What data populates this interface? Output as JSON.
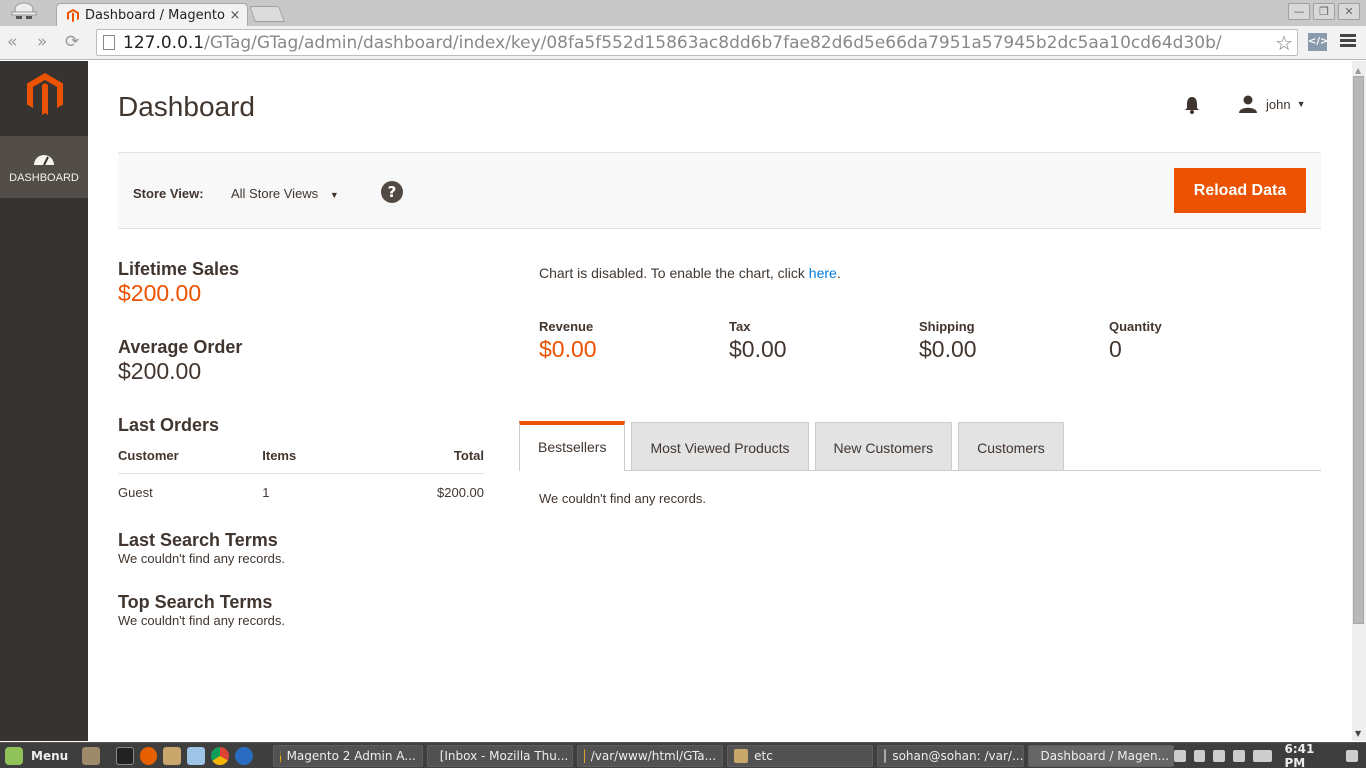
{
  "browser": {
    "tab_title": "Dashboard / Magento A",
    "tab_close": "×",
    "url_host": "127.0.0.1",
    "url_path": "/GTag/GTag/admin/dashboard/index/key/08fa5f552d15863ac8dd6b7fae82d6d5e66da7951a57945b2dc5aa10cd64d30b/",
    "star_glyph": "☆",
    "devtools_glyph": "</>",
    "window_buttons": [
      "—",
      "❐",
      "✕"
    ],
    "icons": [
      "incognito-icon",
      "back-icon",
      "forward-icon",
      "reload-icon",
      "page-icon",
      "bookmark-star-icon",
      "devtools-icon",
      "menu-icon"
    ]
  },
  "sidebar": {
    "items": [
      {
        "label": "DASHBOARD",
        "icon": "gauge-icon"
      }
    ]
  },
  "header": {
    "title": "Dashboard",
    "user_name": "john",
    "caret": "▼"
  },
  "store_view": {
    "label": "Store View:",
    "selected": "All Store Views",
    "caret": "▼",
    "help": "?",
    "reload_button": "Reload Data"
  },
  "left": {
    "lifetime_sales": {
      "label": "Lifetime Sales",
      "value": "$200.00"
    },
    "average_order": {
      "label": "Average Order",
      "value": "$200.00"
    },
    "last_orders": {
      "title": "Last Orders",
      "columns": [
        "Customer",
        "Items",
        "Total"
      ],
      "rows": [
        {
          "customer": "Guest",
          "items": "1",
          "total": "$200.00"
        }
      ]
    },
    "last_search_terms": {
      "title": "Last Search Terms",
      "empty": "We couldn't find any records."
    },
    "top_search_terms": {
      "title": "Top Search Terms",
      "empty": "We couldn't find any records."
    }
  },
  "right": {
    "chart_msg": "Chart is disabled. To enable the chart, click ",
    "chart_link": "here",
    "chart_msg_end": ".",
    "totals": [
      {
        "label": "Revenue",
        "value": "$0.00"
      },
      {
        "label": "Tax",
        "value": "$0.00"
      },
      {
        "label": "Shipping",
        "value": "$0.00"
      },
      {
        "label": "Quantity",
        "value": "0"
      }
    ],
    "tabs": [
      "Bestsellers",
      "Most Viewed Products",
      "New Customers",
      "Customers"
    ],
    "active_tab": "Bestsellers",
    "tab_content": "We couldn't find any records."
  },
  "colors": {
    "accent": "#eb5202",
    "sidebar": "#373330",
    "link": "#007bdb",
    "text": "#41362f"
  },
  "taskbar": {
    "menu_label": "Menu",
    "tasks": [
      "Magento 2 Admin A...",
      "[Inbox - Mozilla Thu...",
      "/var/www/html/GTa...",
      "etc",
      "sohan@sohan: /var/...",
      "Dashboard / Magen..."
    ],
    "clock": "6:41 PM"
  }
}
